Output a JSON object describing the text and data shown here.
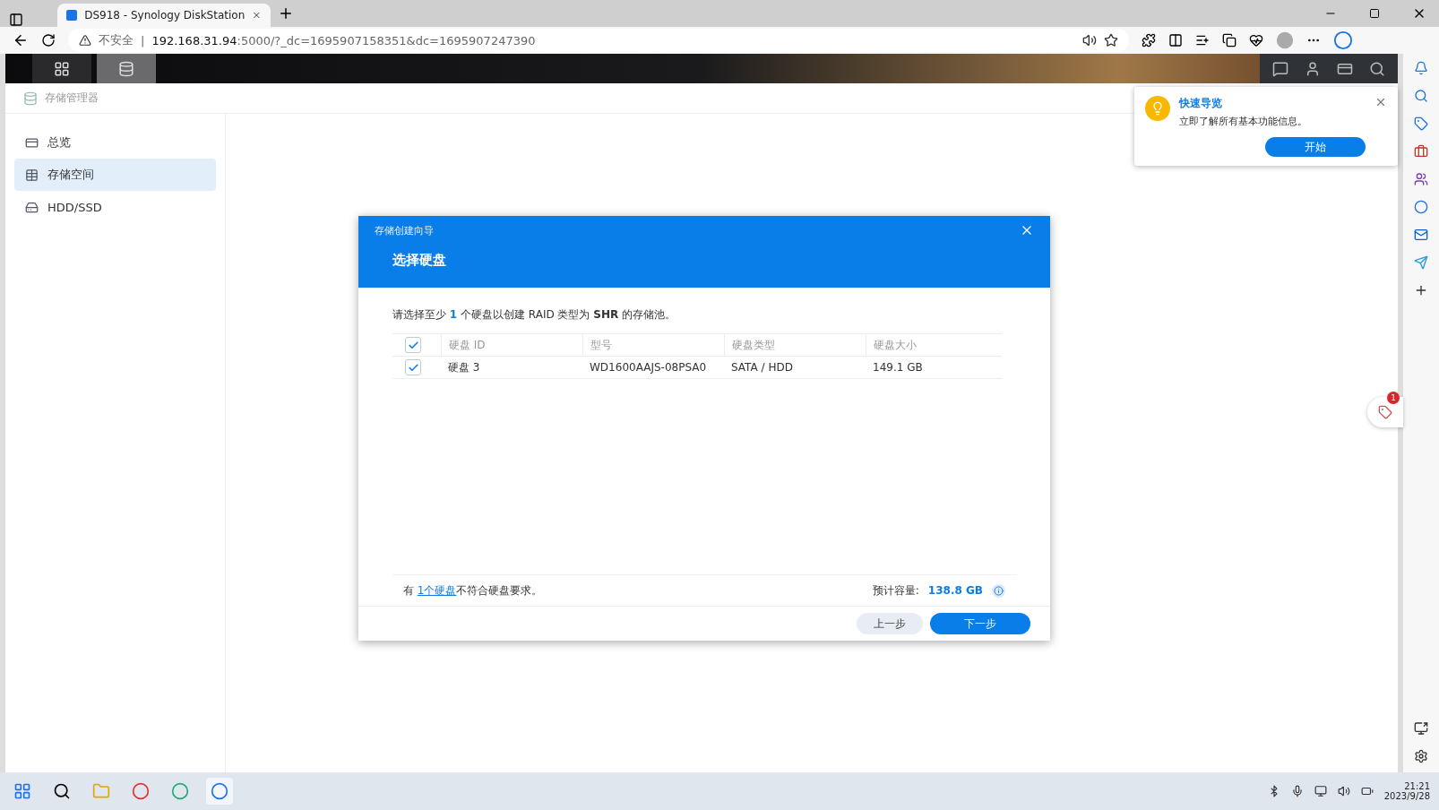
{
  "browser": {
    "tab_title": "DS918 - Synology DiskStation",
    "address": {
      "warning": "不安全",
      "separator": "|",
      "host": "192.168.31.94",
      "path": ":5000/?_dc=1695907158351&dc=1695907247390"
    }
  },
  "app": {
    "title": "存储管理器",
    "sidebar": [
      {
        "kind": "overview",
        "label": "总览",
        "selected": false
      },
      {
        "kind": "storage",
        "label": "存储空间",
        "selected": true
      },
      {
        "kind": "disk",
        "label": "HDD/SSD",
        "selected": false
      }
    ]
  },
  "wizard": {
    "title": "存储创建向导",
    "heading": "选择硬盘",
    "instruction": "请选择至少 **1** 个硬盘以创建 RAID 类型为 **SHR** 的存储池。",
    "table": {
      "all_checked": true,
      "columns": [
        "硬盘 ID",
        "型号",
        "硬盘类型",
        "硬盘大小"
      ],
      "rows": [
        {
          "checked": true,
          "cells": [
            "硬盘 3",
            "WD1600AAJS-08PSA0",
            "SATA / HDD",
            "149.1 GB"
          ]
        }
      ]
    },
    "note": {
      "prefix": "有 ",
      "link": "1个硬盘",
      "suffix": "不符合硬盘要求。"
    },
    "capacity": {
      "label": "预计容量:",
      "value": "138.8 GB"
    },
    "buttons": [
      {
        "label": "上一步",
        "kind": "secondary"
      },
      {
        "label": "下一步",
        "kind": "primary"
      }
    ]
  },
  "tour": {
    "title": "快速导览",
    "text": "立即了解所有基本功能信息。",
    "button": "开始"
  },
  "float_badge": "1",
  "taskbar": {
    "time": "21:21",
    "date": "2023/9/28"
  }
}
